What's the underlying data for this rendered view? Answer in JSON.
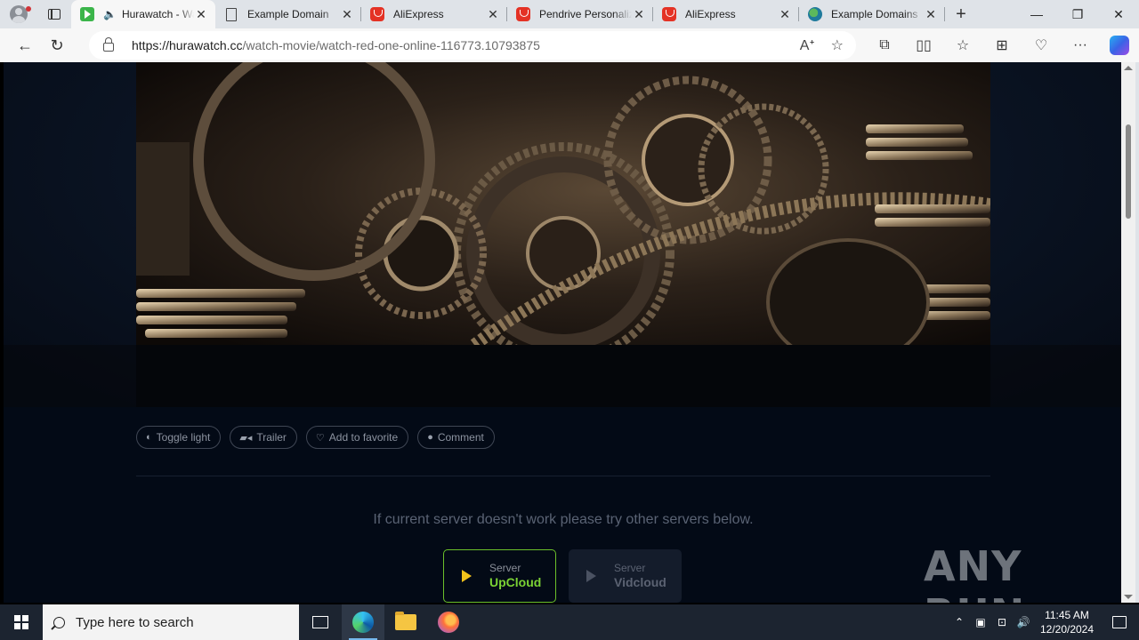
{
  "browser": {
    "tabs": [
      {
        "title": "Hurawatch - Watch",
        "favicon": "hurawatch-icon",
        "audio": true,
        "active": true
      },
      {
        "title": "Example Domain",
        "favicon": "document-icon"
      },
      {
        "title": "AliExpress",
        "favicon": "aliexpress-icon"
      },
      {
        "title": "Pendrive Personalizado",
        "favicon": "aliexpress-icon"
      },
      {
        "title": "AliExpress",
        "favicon": "aliexpress-icon"
      },
      {
        "title": "Example Domains",
        "favicon": "globe-icon"
      }
    ],
    "url_host": "https://hurawatch.cc",
    "url_path": "/watch-movie/watch-red-one-online-116773.10793875"
  },
  "page": {
    "actions": [
      {
        "label": "Toggle light",
        "icon": "contrast-icon"
      },
      {
        "label": "Trailer",
        "icon": "video-camera-icon"
      },
      {
        "label": "Add to favorite",
        "icon": "heart-icon"
      },
      {
        "label": "Comment",
        "icon": "comment-icon"
      }
    ],
    "notice": "If current server doesn't work please try other servers below.",
    "servers": [
      {
        "caption": "Server",
        "name": "UpCloud",
        "active": true
      },
      {
        "caption": "Server",
        "name": "Vidcloud",
        "active": false
      }
    ],
    "watermark": "ANY RUN",
    "colors": {
      "accent_green": "#7bd234",
      "play_yellow": "#f2c21b",
      "page_bg": "#030a16"
    }
  },
  "taskbar": {
    "search_placeholder": "Type here to search",
    "time": "11:45 AM",
    "date": "12/20/2024"
  }
}
